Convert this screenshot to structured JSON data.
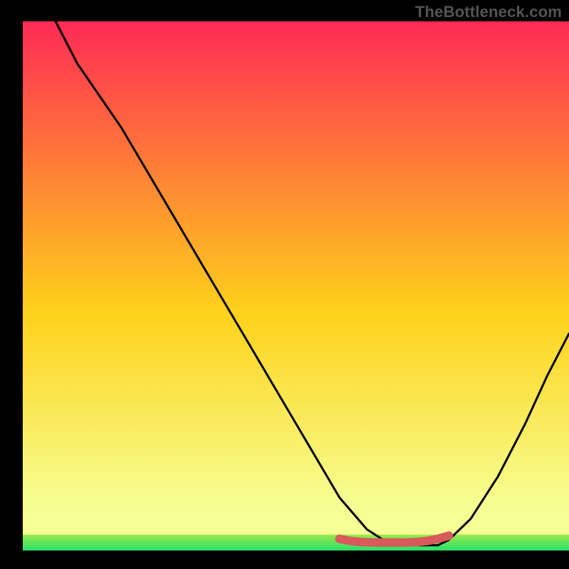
{
  "watermark": {
    "text": "TheBottleneck.com"
  },
  "chart_data": {
    "type": "line",
    "title": "",
    "xlabel": "",
    "ylabel": "",
    "xlim": [
      0,
      100
    ],
    "ylim": [
      0,
      100
    ],
    "background_gradient": {
      "top": "#ff2a55",
      "mid": "#ffd21a",
      "bottom": "#f6ff94"
    },
    "green_band": {
      "ymin": 0,
      "ymax": 3,
      "color_top": "#9be84a",
      "color_bottom": "#27e06b"
    },
    "series": [
      {
        "name": "curve",
        "color": "#000000",
        "x": [
          6,
          10,
          18,
          26,
          34,
          42,
          50,
          58,
          63,
          66,
          70,
          76,
          78,
          82,
          87,
          92,
          96,
          100
        ],
        "values": [
          100,
          92,
          80,
          66,
          52,
          38,
          24,
          10,
          4,
          2,
          1,
          1,
          2,
          6,
          14,
          24,
          33,
          41
        ]
      }
    ],
    "highlight_segment": {
      "color": "#d85a5a",
      "width": 12,
      "x": [
        58,
        60,
        62,
        64,
        66,
        68,
        70,
        72,
        74,
        76,
        78
      ],
      "values": [
        2.2,
        1.8,
        1.6,
        1.5,
        1.5,
        1.5,
        1.5,
        1.6,
        1.8,
        2.2,
        2.8
      ]
    }
  }
}
